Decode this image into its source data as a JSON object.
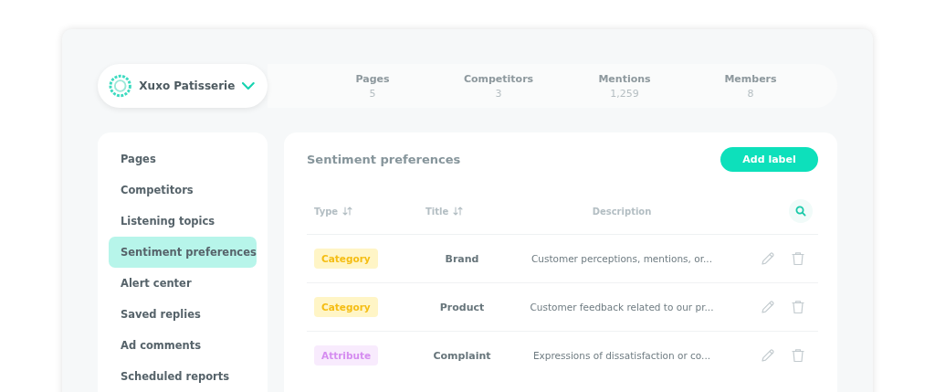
{
  "brand": {
    "name": "Xuxo Patisserie",
    "expanded": false
  },
  "stats": [
    {
      "label": "Pages",
      "value": "5"
    },
    {
      "label": "Competitors",
      "value": "3"
    },
    {
      "label": "Mentions",
      "value": "1,259"
    },
    {
      "label": "Members",
      "value": "8"
    }
  ],
  "sidebar": {
    "items": [
      {
        "label": "Pages",
        "selected": false
      },
      {
        "label": "Competitors",
        "selected": false
      },
      {
        "label": "Listening topics",
        "selected": false
      },
      {
        "label": "Sentiment preferences",
        "selected": true
      },
      {
        "label": "Alert center",
        "selected": false
      },
      {
        "label": "Saved replies",
        "selected": false
      },
      {
        "label": "Ad comments",
        "selected": false
      },
      {
        "label": "Scheduled reports",
        "selected": false
      }
    ]
  },
  "panel": {
    "title": "Sentiment preferences",
    "add_button": "Add label"
  },
  "table": {
    "columns": [
      {
        "label": "Type",
        "sortable": true
      },
      {
        "label": "Title",
        "sortable": true
      },
      {
        "label": "Description",
        "sortable": false
      }
    ],
    "rows": [
      {
        "type": {
          "label": "Category",
          "kind": "category"
        },
        "title": "Brand",
        "description": "Customer perceptions, mentions, or..."
      },
      {
        "type": {
          "label": "Category",
          "kind": "category"
        },
        "title": "Product",
        "description": "Customer feedback related to our pr..."
      },
      {
        "type": {
          "label": "Attribute",
          "kind": "attribute"
        },
        "title": "Complaint",
        "description": "Expressions of dissatisfaction or co..."
      }
    ]
  }
}
